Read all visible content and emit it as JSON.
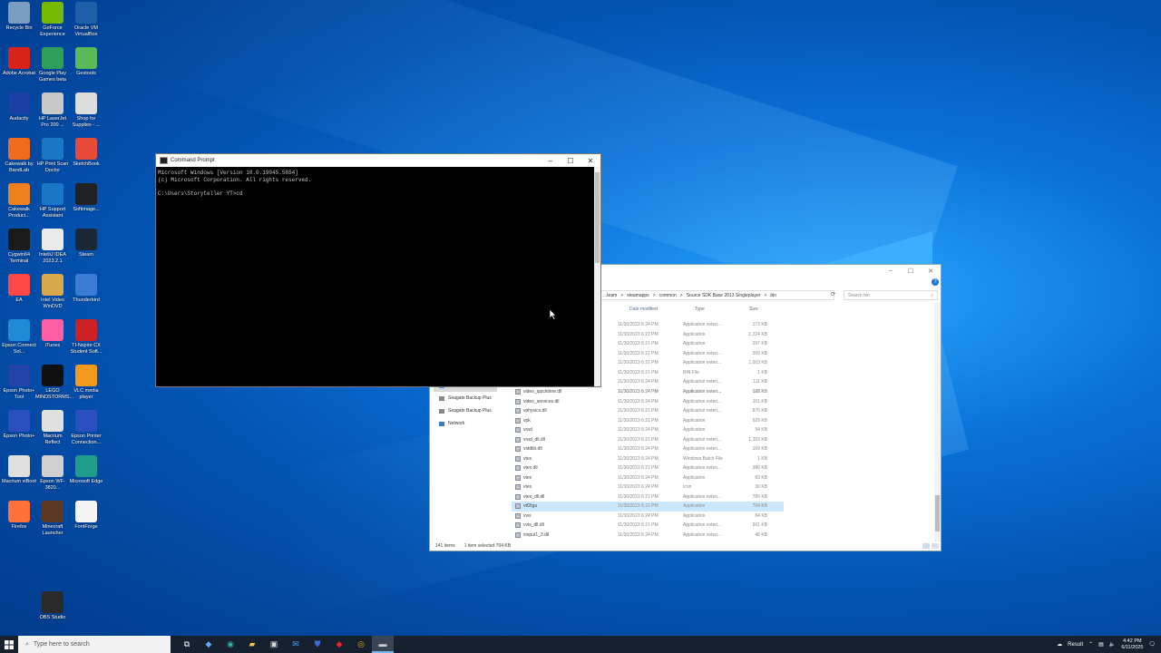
{
  "desktop": {
    "icons": [
      {
        "label": "Recycle Bin",
        "icon": "recycle-bin-icon",
        "color": "#7a9cc2"
      },
      {
        "label": "GeForce Experience",
        "icon": "nvidia-icon",
        "color": "#76b900"
      },
      {
        "label": "Oracle VM VirtualBox",
        "icon": "virtualbox-icon",
        "color": "#1f5fa8"
      },
      {
        "label": "Adobe Acrobat",
        "icon": "acrobat-icon",
        "color": "#d9221a"
      },
      {
        "label": "Google Play Games beta",
        "icon": "google-play-games-icon",
        "color": "#2e9e5b"
      },
      {
        "label": "Gestools",
        "icon": "gestools-icon",
        "color": "#5cb85c"
      },
      {
        "label": "Audacity",
        "icon": "audacity-icon",
        "color": "#1c3fa6"
      },
      {
        "label": "HP LaserJet Pro 200 ...",
        "icon": "printer-icon",
        "color": "#c8c8c8"
      },
      {
        "label": "Shop for Supplies - ...",
        "icon": "printer-shop-icon",
        "color": "#dcdcdc"
      },
      {
        "label": "Cakewalk by BandLab",
        "icon": "cakewalk-icon",
        "color": "#f26b1d"
      },
      {
        "label": "HP Print Scan Doctor",
        "icon": "hp-doctor-icon",
        "color": "#1a76c8"
      },
      {
        "label": "SketchBook",
        "icon": "sketchbook-icon",
        "color": "#e84a3a"
      },
      {
        "label": "Cakewalk Product...",
        "icon": "cakewalk-center-icon",
        "color": "#f0801e"
      },
      {
        "label": "HP Support Assistant",
        "icon": "hp-support-icon",
        "color": "#1a76c8"
      },
      {
        "label": "Softimage...",
        "icon": "softimage-icon",
        "color": "#222"
      },
      {
        "label": "Cygwin64 Terminal",
        "icon": "cygwin-icon",
        "color": "#1a1a1a"
      },
      {
        "label": "IntelliJ IDEA 2023.2.1",
        "icon": "intellij-icon",
        "color": "#eaeaea"
      },
      {
        "label": "Steam",
        "icon": "steam-icon",
        "color": "#1b2838"
      },
      {
        "label": "EA",
        "icon": "ea-icon",
        "color": "#ff4747"
      },
      {
        "label": "Intel Video WinDVD",
        "icon": "windvd-icon",
        "color": "#d8a84a"
      },
      {
        "label": "Thunderbird",
        "icon": "thunderbird-icon",
        "color": "#3a7bd5"
      },
      {
        "label": "Epson Connect Sol...",
        "icon": "edge-dev-icon",
        "color": "#1f8ad8"
      },
      {
        "label": "iTunes",
        "icon": "itunes-icon",
        "color": "#ff5fa2"
      },
      {
        "label": "TI-Nspire CX Student Soft...",
        "icon": "ti-nspire-icon",
        "color": "#cc2222"
      },
      {
        "label": "Epson Photo+ Tool",
        "icon": "epson-photo-icon",
        "color": "#2244aa"
      },
      {
        "label": "LEGO MINDSTORMS...",
        "icon": "lego-mindstorms-icon",
        "color": "#111"
      },
      {
        "label": "VLC media player",
        "icon": "vlc-icon",
        "color": "#f39a1c"
      },
      {
        "label": "Epson Photo+",
        "icon": "epson-photoplus-icon",
        "color": "#2a4fbf"
      },
      {
        "label": "Macrium Reflect",
        "icon": "macrium-icon",
        "color": "#e0e0e0"
      },
      {
        "label": "Epson Printer Connection...",
        "icon": "epson-printer-icon",
        "color": "#2a4fbf"
      },
      {
        "label": "Macrium viBoot",
        "icon": "viboot-icon",
        "color": "#e0e0e0"
      },
      {
        "label": "Epson WF-3820...",
        "icon": "epson-wf-icon",
        "color": "#d0d0d0"
      },
      {
        "label": "Microsoft Edge",
        "icon": "edge-icon",
        "color": "#1f9d8a"
      },
      {
        "label": "Firefox",
        "icon": "firefox-icon",
        "color": "#ff7139"
      },
      {
        "label": "Minecraft Launcher",
        "icon": "minecraft-icon",
        "color": "#5a3a22"
      },
      {
        "label": "FontForge",
        "icon": "fontforge-icon",
        "color": "#f4f4f4"
      },
      {
        "label": "OBS Studio",
        "icon": "obs-icon",
        "color": "#2a2a2a"
      }
    ]
  },
  "cmd": {
    "title": "Command Prompt",
    "lines": [
      "Microsoft Windows [Version 10.0.19045.5854]",
      "(c) Microsoft Corporation. All rights reserved.",
      "",
      "C:\\Users\\Storyteller YT>cd"
    ]
  },
  "explorer": {
    "address": [
      "...team",
      ">",
      "steamapps",
      ">",
      "common",
      ">",
      "Source SDK Base 2013 Singleplayer",
      ">",
      "bin"
    ],
    "search_placeholder": "Search bin",
    "columns": {
      "date": "Date modified",
      "type": "Type",
      "size": "Size"
    },
    "nav": [
      {
        "label": "OneDrive",
        "icon": "onedrive-icon"
      },
      {
        "label": "This PC",
        "icon": "this-pc-icon",
        "selected": true
      },
      {
        "label": "Seagate Backup Plus",
        "icon": "drive-icon"
      },
      {
        "label": "Seagate Backup Plus",
        "icon": "drive-icon"
      },
      {
        "label": "Network",
        "icon": "network-icon"
      }
    ],
    "hidden_rows": [
      {
        "date": "11/30/2023 6:24 PM",
        "type": "Application exten...",
        "size": "173 KB"
      },
      {
        "date": "11/30/2023 6:21 PM",
        "type": "Application",
        "size": "1,224 KB"
      },
      {
        "date": "11/30/2023 6:21 PM",
        "type": "Application",
        "size": "297 KB"
      },
      {
        "date": "11/30/2023 6:21 PM",
        "type": "Application exten...",
        "size": "359 KB"
      },
      {
        "date": "11/30/2023 6:21 PM",
        "type": "Application exten...",
        "size": "1,003 KB"
      },
      {
        "date": "11/30/2023 6:21 PM",
        "type": "BIN File",
        "size": "1 KB"
      },
      {
        "date": "11/30/2023 6:24 PM",
        "type": "Application exten...",
        "size": "111 KB"
      },
      {
        "date": "11/30/2023 6:24 PM",
        "type": "Application exten...",
        "size": "120 KB"
      }
    ],
    "rows": [
      {
        "name": "video_quicktime.dll",
        "date": "11/30/2023 6:24 PM",
        "type": "Application exten...",
        "size": "101 KB"
      },
      {
        "name": "video_services.dll",
        "date": "11/30/2023 6:24 PM",
        "type": "Application exten...",
        "size": "101 KB"
      },
      {
        "name": "vphysics.dll",
        "date": "11/30/2023 6:21 PM",
        "type": "Application exten...",
        "size": "870 KB"
      },
      {
        "name": "vpk",
        "date": "11/30/2023 6:21 PM",
        "type": "Application",
        "size": "629 KB"
      },
      {
        "name": "vrad",
        "date": "11/30/2023 6:24 PM",
        "type": "Application",
        "size": "94 KB"
      },
      {
        "name": "vrad_dll.dll",
        "date": "11/30/2023 6:21 PM",
        "type": "Application exten...",
        "size": "1,353 KB"
      },
      {
        "name": "vstdlib.dll",
        "date": "11/30/2023 6:24 PM",
        "type": "Application exten...",
        "size": "169 KB"
      },
      {
        "name": "vtex",
        "date": "11/30/2023 6:24 PM",
        "type": "Windows Batch File",
        "size": "1 KB"
      },
      {
        "name": "vtex.dll",
        "date": "11/30/2023 6:21 PM",
        "type": "Application exten...",
        "size": "380 KB"
      },
      {
        "name": "vtex",
        "date": "11/30/2023 6:24 PM",
        "type": "Application",
        "size": "83 KB"
      },
      {
        "name": "vtex",
        "date": "11/30/2023 6:24 PM",
        "type": "Icon",
        "size": "30 KB"
      },
      {
        "name": "vtex_dll.dll",
        "date": "11/30/2023 6:21 PM",
        "type": "Application exten...",
        "size": "789 KB"
      },
      {
        "name": "vtf2tga",
        "date": "11/30/2023 6:21 PM",
        "type": "Application",
        "size": "704 KB",
        "selected": true
      },
      {
        "name": "vvis",
        "date": "11/30/2023 6:24 PM",
        "type": "Application",
        "size": "84 KB"
      },
      {
        "name": "vvis_dll.dll",
        "date": "11/30/2023 6:21 PM",
        "type": "Application exten...",
        "size": "501 KB"
      },
      {
        "name": "xinput1_3.dll",
        "date": "11/30/2023 6:24 PM",
        "type": "Application exten...",
        "size": "48 KB"
      }
    ],
    "status": {
      "count": "141 items",
      "selection": "1 item selected  704 KB"
    }
  },
  "taskbar": {
    "search_placeholder": "Type here to search",
    "apps": [
      "task-view-icon",
      "copilot-icon",
      "edge-icon",
      "file-explorer-icon",
      "store-icon",
      "mail-icon",
      "security-icon",
      "app-red-icon",
      "chrome-icon",
      "cmd-icon"
    ],
    "tray_label": "Result",
    "time": "4:42 PM",
    "date": "6/11/2025"
  }
}
